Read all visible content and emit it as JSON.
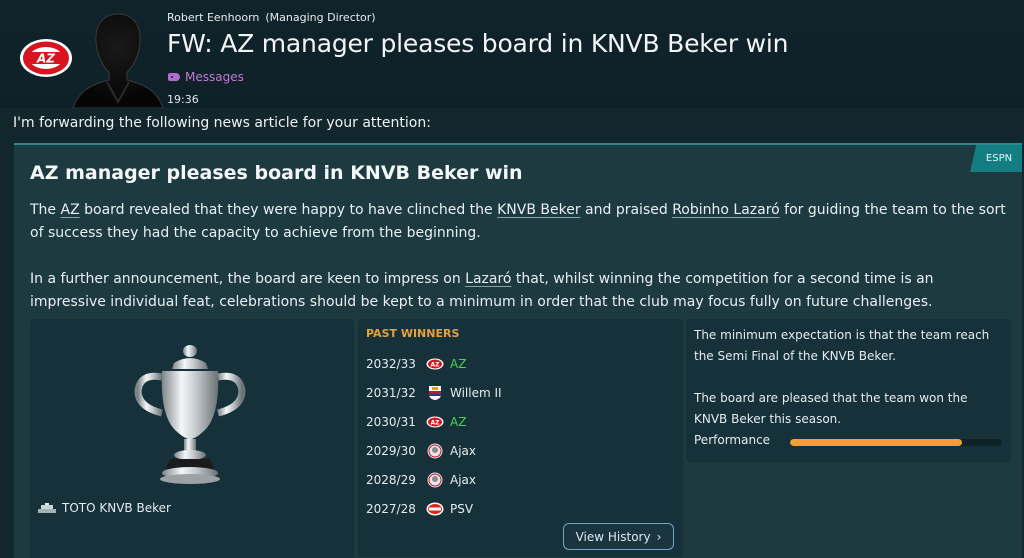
{
  "header": {
    "sender_name": "Robert Eenhoorn",
    "sender_role": "(Managing Director)",
    "headline": "FW: AZ manager pleases board in KNVB Beker win",
    "category": "Messages",
    "time": "19:36",
    "club_logo_icon": "az-club-logo",
    "avatar_icon": "person-silhouette-icon"
  },
  "intro": "I'm forwarding the following news article for your attention:",
  "article": {
    "source": "ESPN",
    "title": "AZ manager pleases board in KNVB Beker win",
    "p1_a": "The ",
    "p1_link_club": "AZ",
    "p1_b": " board revealed that they were happy to have clinched the ",
    "p1_link_comp": "KNVB Beker",
    "p1_c": " and praised ",
    "p1_link_manager": "Robinho Lazaró",
    "p1_d": " for guiding the team to the sort of success they had the capacity to achieve from the beginning.",
    "p2_a": "In a further announcement, the board are keen to impress on ",
    "p2_link_manager": "Lazaró",
    "p2_b": " that, whilst winning the competition for a second time is an impressive individual feat, celebrations should be kept to a minimum in order that the club may focus fully on future challenges."
  },
  "trophy": {
    "label": "TOTO KNVB Beker",
    "icon": "trophy-cup-icon"
  },
  "past_winners": {
    "heading": "PAST WINNERS",
    "rows": [
      {
        "season": "2032/33",
        "club": "AZ"
      },
      {
        "season": "2031/32",
        "club": "Willem II"
      },
      {
        "season": "2030/31",
        "club": "AZ"
      },
      {
        "season": "2029/30",
        "club": "Ajax"
      },
      {
        "season": "2028/29",
        "club": "Ajax"
      },
      {
        "season": "2027/28",
        "club": "PSV"
      }
    ],
    "button": "View History"
  },
  "expectation": {
    "line1": "The minimum expectation is that the team reach the Semi Final of the KNVB Beker.",
    "line2": "The board are pleased that the team won the KNVB Beker this season.",
    "performance_label": "Performance",
    "performance_level": 0.81
  },
  "colors": {
    "accent_teal": "#127e82",
    "winner_green": "#4cd24c",
    "heading_orange": "#e8a13a",
    "bar_orange": "#f0a030",
    "tag_purple": "#c07ad8"
  }
}
